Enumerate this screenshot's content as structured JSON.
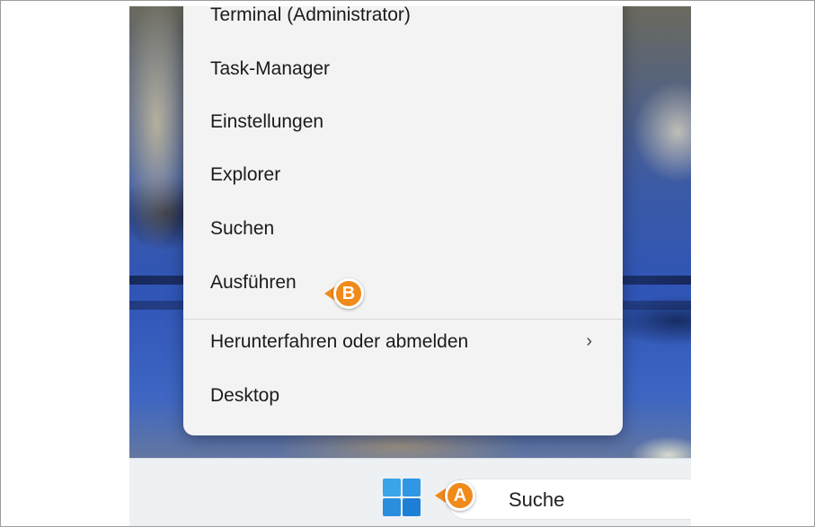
{
  "menu": {
    "items": [
      {
        "label": "Terminal (Administrator)"
      },
      {
        "label": "Task-Manager"
      },
      {
        "label": "Einstellungen"
      },
      {
        "label": "Explorer"
      },
      {
        "label": "Suchen"
      },
      {
        "label": "Ausführen"
      },
      {
        "label": "Herunterfahren oder abmelden"
      },
      {
        "label": "Desktop"
      }
    ],
    "submenu_chevron": "›"
  },
  "taskbar": {
    "search_label": "Suche",
    "start_icon": "windows-start-icon"
  },
  "callouts": {
    "a": "A",
    "b": "B",
    "color": "#f08a1a"
  }
}
